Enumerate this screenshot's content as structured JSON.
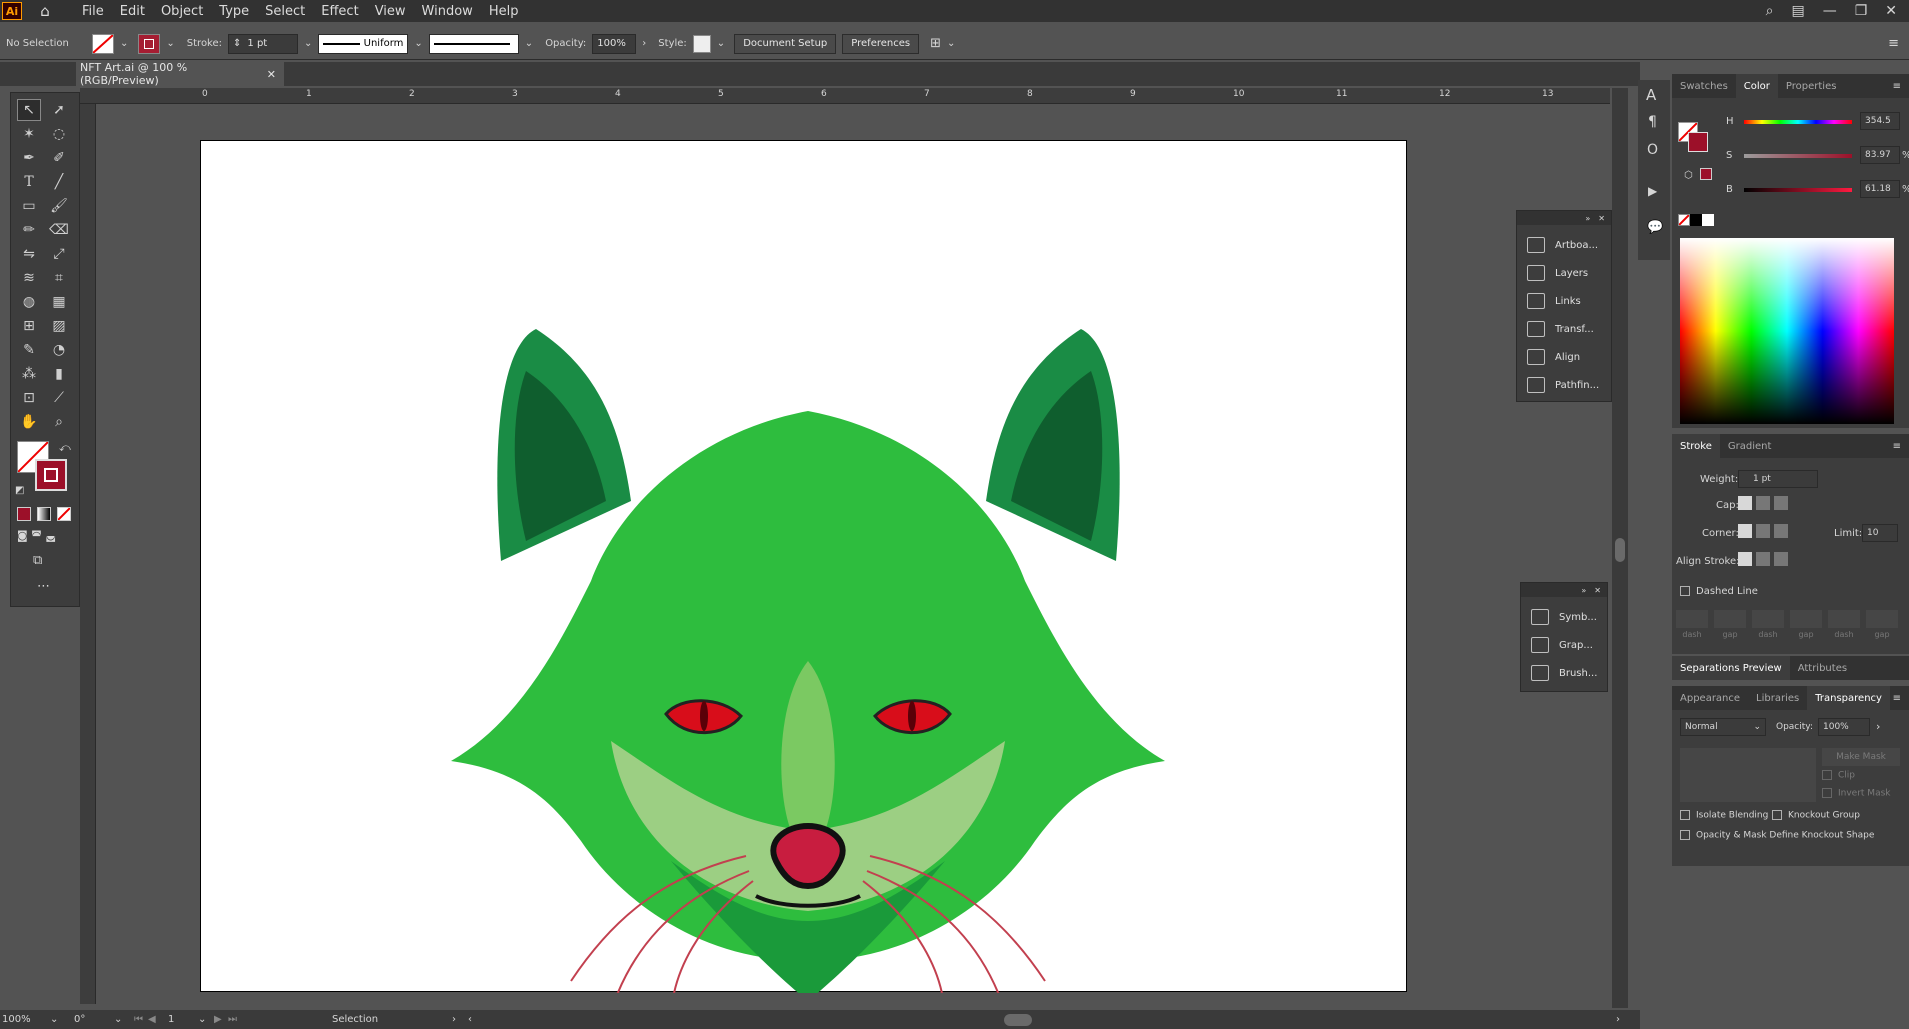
{
  "app": {
    "logo": "Ai"
  },
  "menu": [
    "File",
    "Edit",
    "Object",
    "Type",
    "Select",
    "Effect",
    "View",
    "Window",
    "Help"
  ],
  "control_bar": {
    "selection_status": "No Selection",
    "stroke_label": "Stroke:",
    "stroke_value": "1 pt",
    "stroke_profile": "Uniform",
    "opacity_label": "Opacity:",
    "opacity_value": "100%",
    "style_label": "Style:",
    "document_setup": "Document Setup",
    "preferences": "Preferences"
  },
  "document_tab": {
    "title": "NFT Art.ai @ 100 % (RGB/Preview)"
  },
  "ruler_ticks": [
    "0",
    "1",
    "2",
    "3",
    "4",
    "5",
    "6",
    "7",
    "8",
    "9",
    "10",
    "11",
    "12",
    "13"
  ],
  "floating_panel_1": [
    "Artboa...",
    "Layers",
    "Links",
    "Transf...",
    "Align",
    "Pathfin..."
  ],
  "floating_panel_2": [
    "Symb...",
    "Grap...",
    "Brush..."
  ],
  "color_panel": {
    "tabs": [
      "Swatches",
      "Color",
      "Properties"
    ],
    "active_tab": "Color",
    "h_label": "H",
    "h_value": "354.5",
    "s_label": "S",
    "s_value": "83.97",
    "b_label": "B",
    "b_value": "61.18",
    "percent": "%",
    "stroke_color": "#9c1029"
  },
  "stroke_panel": {
    "tabs": [
      "Stroke",
      "Gradient"
    ],
    "weight_label": "Weight:",
    "weight_value": "1 pt",
    "cap_label": "Cap:",
    "corner_label": "Corner:",
    "limit_label": "Limit:",
    "limit_value": "10",
    "align_label": "Align Stroke:",
    "dashed_label": "Dashed Line",
    "dash_labels": [
      "dash",
      "gap",
      "dash",
      "gap",
      "dash",
      "gap"
    ]
  },
  "sep_panel": {
    "tabs": [
      "Separations Preview",
      "Attributes"
    ]
  },
  "transparency_panel": {
    "tabs": [
      "Appearance",
      "Libraries",
      "Transparency"
    ],
    "blend_mode": "Normal",
    "opacity_label": "Opacity:",
    "opacity_value": "100%",
    "make_mask": "Make Mask",
    "clip": "Clip",
    "invert_mask": "Invert Mask",
    "isolate": "Isolate Blending",
    "knockout": "Knockout Group",
    "opacity_mask": "Opacity & Mask Define Knockout Shape"
  },
  "status_bar": {
    "zoom": "100%",
    "rotation": "0°",
    "artboard_num": "1",
    "tool": "Selection"
  }
}
